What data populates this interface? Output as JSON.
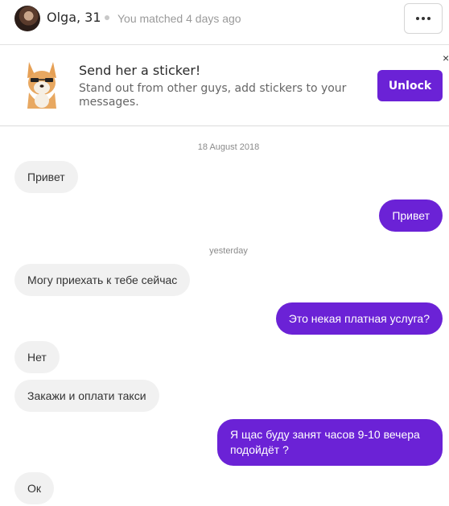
{
  "header": {
    "name": "Olga, 31",
    "matched": "You matched 4 days ago"
  },
  "promo": {
    "title": "Send her a sticker!",
    "text": "Stand out from other guys, add stickers to your messages.",
    "unlock_label": "Unlock",
    "close_glyph": "×"
  },
  "chat": {
    "date_1": "18 August 2018",
    "date_2": "yesterday",
    "messages": [
      {
        "dir": "in",
        "text": "Привет"
      },
      {
        "dir": "out",
        "text": "Привет"
      },
      {
        "dir": "in",
        "text": "Могу приехать к тебе сейчас"
      },
      {
        "dir": "out",
        "text": "Это некая платная услуга?"
      },
      {
        "dir": "in",
        "text": "Нет"
      },
      {
        "dir": "in",
        "text": "Закажи и оплати такси"
      },
      {
        "dir": "out",
        "text": "Я щас буду занят часов 9-10 вечера подойдёт ?"
      },
      {
        "dir": "in",
        "text": "Ок"
      }
    ]
  },
  "colors": {
    "accent": "#6b22d6",
    "incoming_bubble": "#f1f1f1"
  },
  "icons": {
    "more": "more-horizontal-icon",
    "close": "close-icon",
    "sticker": "dog-sticker-icon"
  }
}
